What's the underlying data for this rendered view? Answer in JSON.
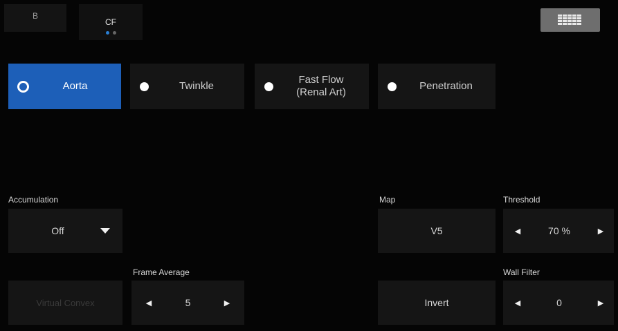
{
  "tabs": [
    {
      "label": "B",
      "active": false
    },
    {
      "label": "CF",
      "active": true
    }
  ],
  "page_indicator": {
    "pages": 2,
    "current": 1
  },
  "presets": [
    {
      "label": "Aorta",
      "selected": true
    },
    {
      "label": "Twinkle",
      "selected": false
    },
    {
      "label": "Fast Flow\n(Renal Art)",
      "selected": false
    },
    {
      "label": "Penetration",
      "selected": false
    }
  ],
  "accumulation": {
    "label": "Accumulation",
    "value": "Off"
  },
  "map": {
    "label": "Map",
    "value": "V5"
  },
  "threshold": {
    "label": "Threshold",
    "value": "70 %"
  },
  "frame_average": {
    "label": "Frame Average",
    "value": "5"
  },
  "wall_filter": {
    "label": "Wall Filter",
    "value": "0"
  },
  "invert": {
    "label": "Invert"
  },
  "virtual_convex": {
    "label": "Virtual Convex"
  },
  "colors": {
    "accent": "#1d5fb8",
    "background": "#050505",
    "button": "#151515"
  },
  "icons": {
    "menu": "grid-icon",
    "left": "left-arrow-icon",
    "right": "right-arrow-icon",
    "dropdown": "dropdown-arrow-icon"
  }
}
